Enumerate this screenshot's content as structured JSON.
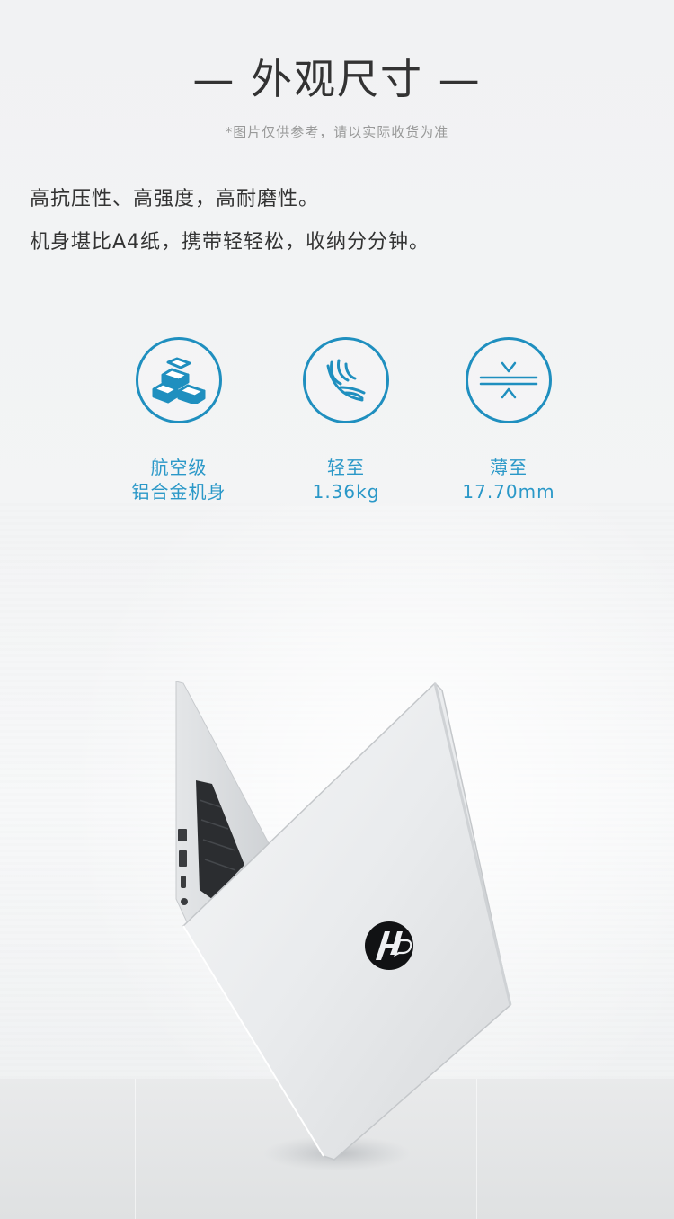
{
  "header": {
    "title": "— 外观尺寸 —",
    "subtitle": "*图片仅供参考，请以实际收货为准"
  },
  "description": {
    "line1": "高抗压性、高强度，高耐磨性。",
    "line2": "机身堪比A4纸，携带轻轻松，收纳分分钟。"
  },
  "features": [
    {
      "icon": "metal-ingots-icon",
      "line1": "航空级",
      "line2": "铝合金机身"
    },
    {
      "icon": "feather-icon",
      "line1": "轻至",
      "line2": "1.36kg"
    },
    {
      "icon": "thickness-arrows-icon",
      "line1": "薄至",
      "line2": "17.70mm"
    }
  ],
  "colors": {
    "accent": "#1f8fbf",
    "label": "#2a98c8",
    "title": "#333333",
    "subtitle": "#999999"
  }
}
